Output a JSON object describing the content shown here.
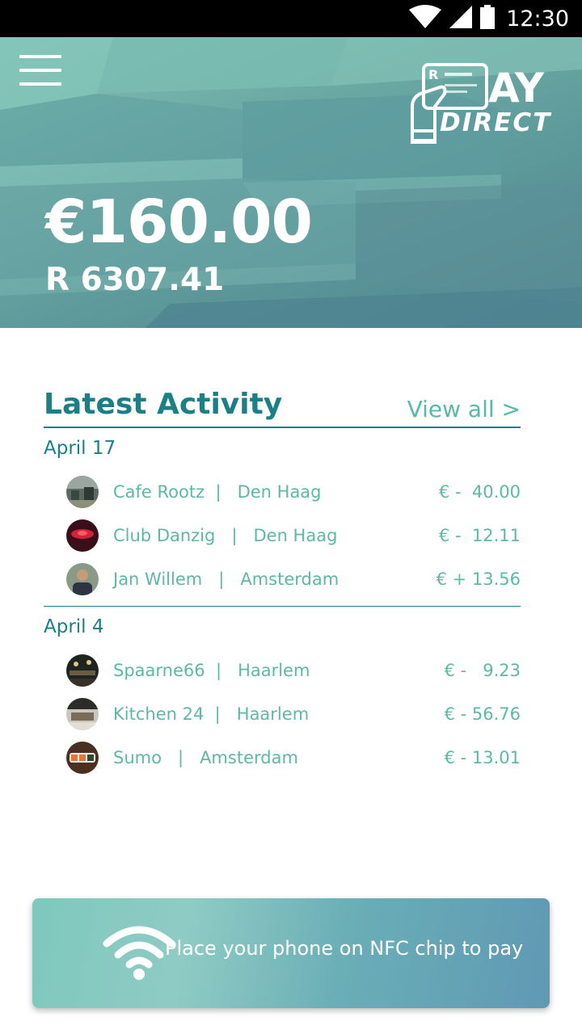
{
  "status_bar": {
    "time": "12:30",
    "wifi_icon": "wifi-icon",
    "signal_icon": "signal-icon",
    "battery_icon": "battery-icon"
  },
  "header": {
    "menu_icon": "hamburger-menu-icon",
    "logo": {
      "text_top": "AY",
      "text_bottom": "DIRECT"
    },
    "balance_eur": "€160.00",
    "balance_zar": "R 6307.41"
  },
  "activity": {
    "title": "Latest Activity",
    "view_all": "View all >",
    "groups": [
      {
        "date": "April 17",
        "items": [
          {
            "name": "Cafe Rootz  |   Den Haag",
            "amount": "€ -  40.00"
          },
          {
            "name": "Club Danzig   |   Den Haag",
            "amount": "€ -  12.11"
          },
          {
            "name": "Jan Willem   |   Amsterdam",
            "amount": "€ + 13.56"
          }
        ]
      },
      {
        "date": "April 4",
        "items": [
          {
            "name": "Spaarne66  |   Haarlem",
            "amount": "€ -   9.23"
          },
          {
            "name": "Kitchen 24  |   Haarlem",
            "amount": "€ - 56.76"
          },
          {
            "name": "Sumo   |   Amsterdam",
            "amount": "€ - 13.01"
          }
        ]
      }
    ]
  },
  "nfc": {
    "icon": "nfc-wireless-icon",
    "text": "Place your phone on NFC chip to pay"
  },
  "colors": {
    "primary": "#1b7f86",
    "accent": "#5db8a6",
    "header_bg": "#6aa9a3"
  }
}
